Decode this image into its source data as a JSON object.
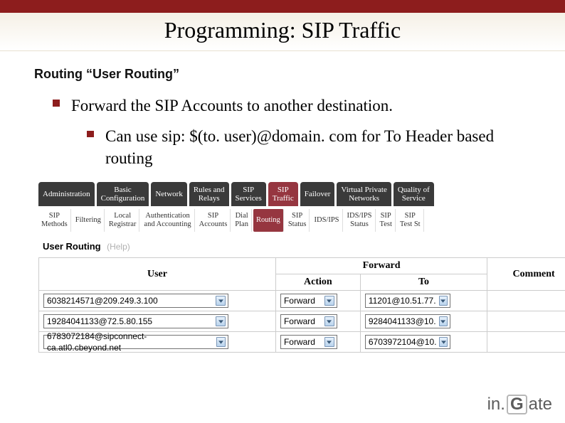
{
  "slide": {
    "title": "Programming: SIP Traffic",
    "subtitle": "Routing “User Routing”",
    "bullets": [
      "Forward the SIP Accounts to another destination."
    ],
    "sub_bullets": [
      "Can use sip: $(to. user)@domain. com for To Header based routing"
    ]
  },
  "nav_tabs": [
    {
      "label": "Administration",
      "active": false
    },
    {
      "label": "Basic\nConfiguration",
      "active": false
    },
    {
      "label": "Network",
      "active": false
    },
    {
      "label": "Rules and\nRelays",
      "active": false
    },
    {
      "label": "SIP\nServices",
      "active": false
    },
    {
      "label": "SIP\nTraffic",
      "active": true
    },
    {
      "label": "Failover",
      "active": false
    },
    {
      "label": "Virtual Private\nNetworks",
      "active": false
    },
    {
      "label": "Quality of\nService",
      "active": false
    }
  ],
  "sub_tabs": [
    {
      "label": "SIP\nMethods",
      "active": false
    },
    {
      "label": "Filtering",
      "active": false
    },
    {
      "label": "Local\nRegistrar",
      "active": false
    },
    {
      "label": "Authentication\nand Accounting",
      "active": false
    },
    {
      "label": "SIP\nAccounts",
      "active": false
    },
    {
      "label": "Dial\nPlan",
      "active": false
    },
    {
      "label": "Routing",
      "active": true
    },
    {
      "label": "SIP\nStatus",
      "active": false
    },
    {
      "label": "IDS/IPS",
      "active": false
    },
    {
      "label": "IDS/IPS\nStatus",
      "active": false
    },
    {
      "label": "SIP\nTest",
      "active": false
    },
    {
      "label": "SIP\nTest St",
      "active": false
    }
  ],
  "section": {
    "heading": "User Routing",
    "help": "(Help)"
  },
  "table": {
    "headers": {
      "user": "User",
      "forward": "Forward",
      "action": "Action",
      "to": "To",
      "comment": "Comment"
    },
    "rows": [
      {
        "user": "6038214571@209.249.3.100",
        "action": "Forward",
        "to": "11201@10.51.77."
      },
      {
        "user": "19284041133@72.5.80.155",
        "action": "Forward",
        "to": "9284041133@10."
      },
      {
        "user": "6783072184@sipconnect-ca.atl0.cbeyond.net",
        "action": "Forward",
        "to": "6703972104@10."
      }
    ]
  },
  "logo": {
    "prefix": "in.",
    "letter": "G",
    "suffix": "ate"
  }
}
